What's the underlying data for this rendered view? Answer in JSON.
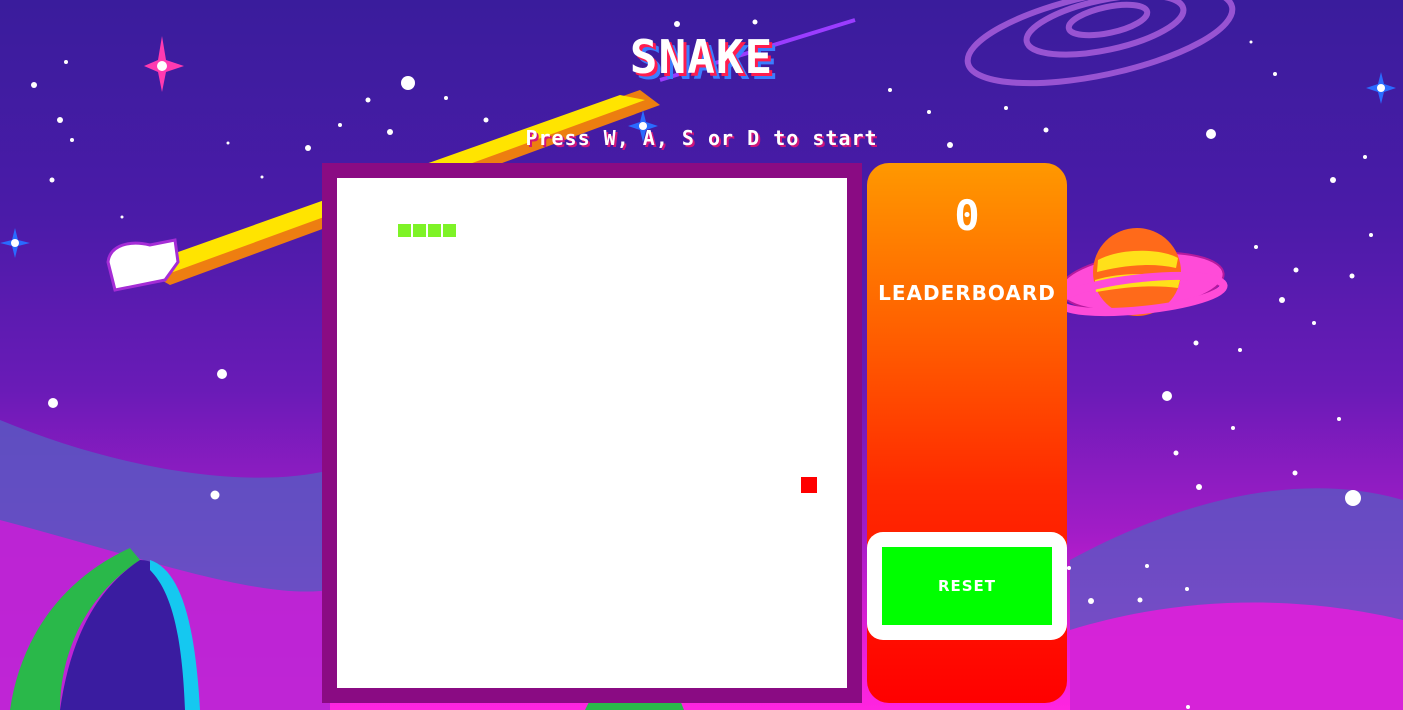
{
  "game": {
    "title": "SNAKE",
    "instruction": "Press W, A, S or D to start",
    "score": "0",
    "leaderboard_label": "LEADERBOARD",
    "reset_label": "RESET",
    "snake_length": 4,
    "colors": {
      "board_frame": "#8a0b83",
      "board": "#ffffff",
      "snake": "#7ef327",
      "food": "#ff0000",
      "reset_button": "#00ff00",
      "sidebar_top": "#ff9800",
      "sidebar_bottom": "#ff0000"
    }
  },
  "background": {
    "theme": "space",
    "decor": [
      "comet",
      "ringed-planet",
      "galaxy-swirl",
      "stars",
      "alien-figures"
    ]
  }
}
